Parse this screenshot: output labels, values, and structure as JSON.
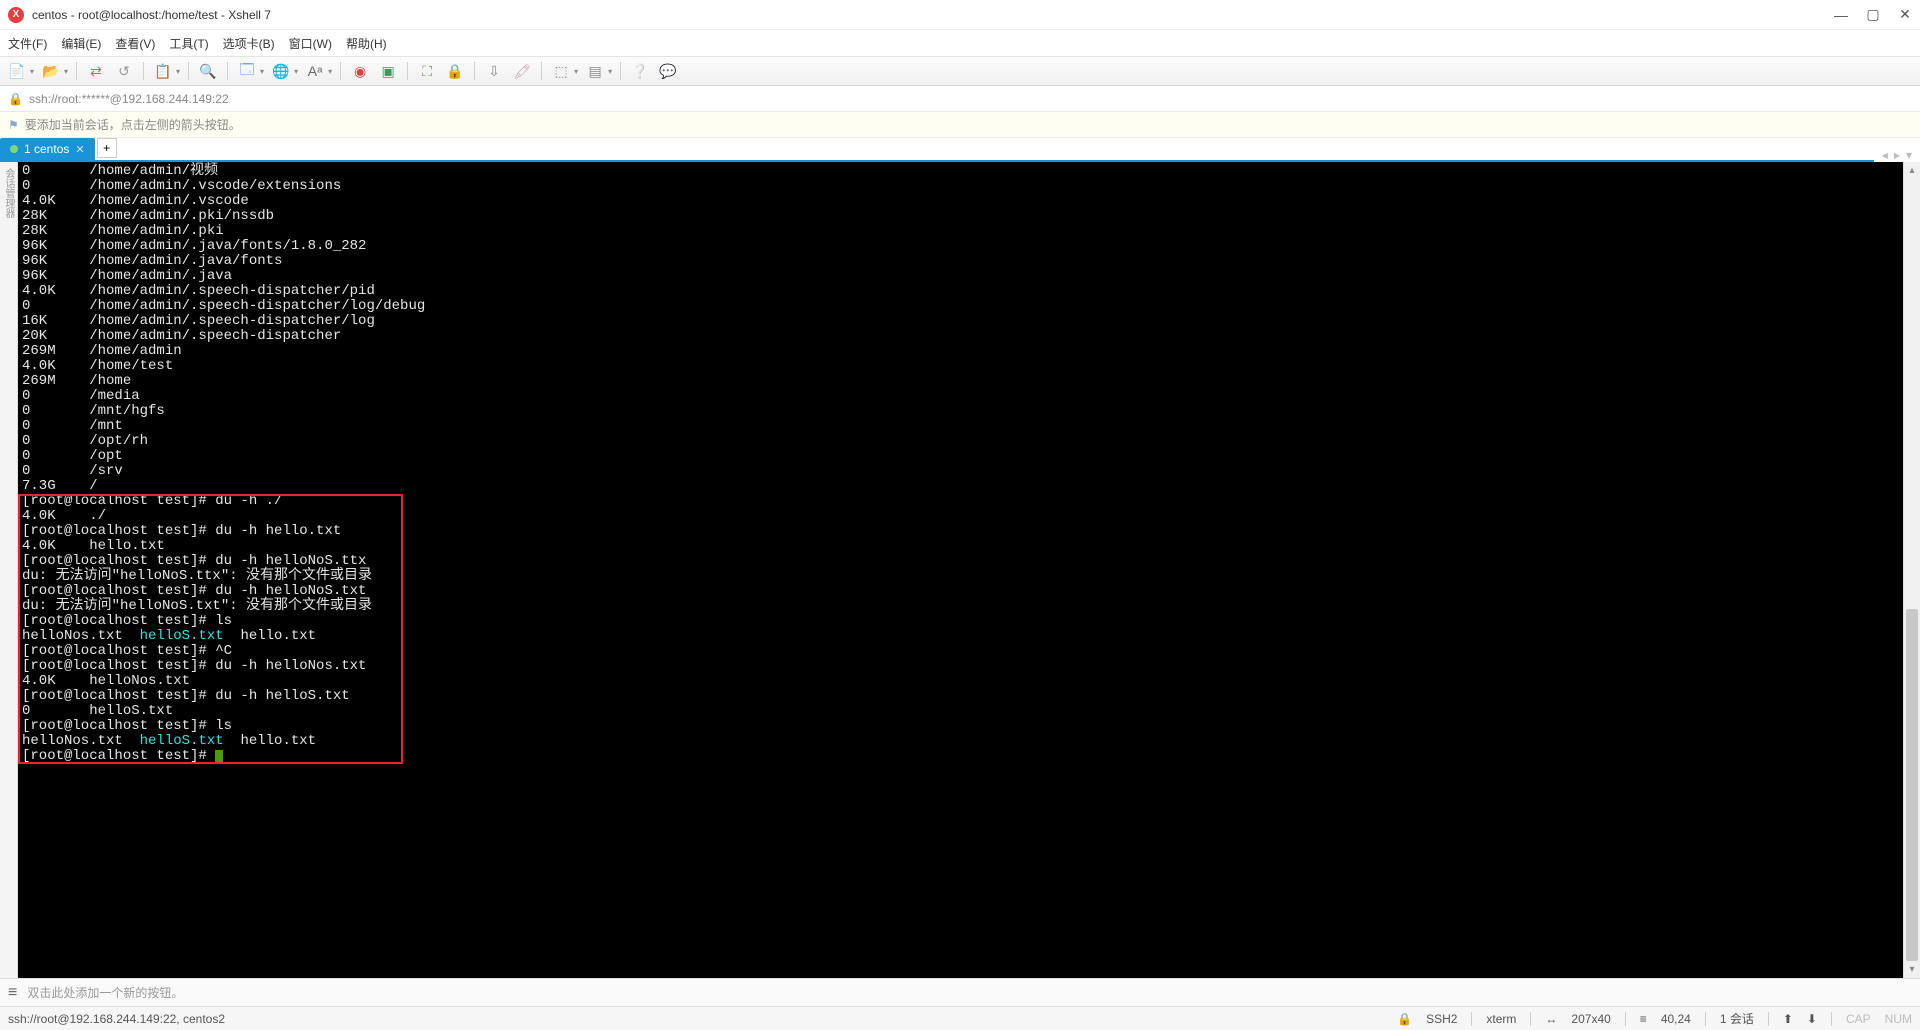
{
  "window": {
    "title": "centos - root@localhost:/home/test - Xshell 7",
    "app_icon_label": "X"
  },
  "menu": {
    "file": "文件(F)",
    "edit": "编辑(E)",
    "view": "查看(V)",
    "tools": "工具(T)",
    "tabs": "选项卡(B)",
    "window": "窗口(W)",
    "help": "帮助(H)"
  },
  "addressbar": {
    "text": "ssh://root:******@192.168.244.149:22"
  },
  "hintbar": {
    "text": "要添加当前会话，点击左侧的箭头按钮。"
  },
  "tab": {
    "label": "1 centos"
  },
  "terminal": {
    "du_lines": [
      {
        "size": "0",
        "path": "/home/admin/视频"
      },
      {
        "size": "0",
        "path": "/home/admin/.vscode/extensions"
      },
      {
        "size": "4.0K",
        "path": "/home/admin/.vscode"
      },
      {
        "size": "28K",
        "path": "/home/admin/.pki/nssdb"
      },
      {
        "size": "28K",
        "path": "/home/admin/.pki"
      },
      {
        "size": "96K",
        "path": "/home/admin/.java/fonts/1.8.0_282"
      },
      {
        "size": "96K",
        "path": "/home/admin/.java/fonts"
      },
      {
        "size": "96K",
        "path": "/home/admin/.java"
      },
      {
        "size": "4.0K",
        "path": "/home/admin/.speech-dispatcher/pid"
      },
      {
        "size": "0",
        "path": "/home/admin/.speech-dispatcher/log/debug"
      },
      {
        "size": "16K",
        "path": "/home/admin/.speech-dispatcher/log"
      },
      {
        "size": "20K",
        "path": "/home/admin/.speech-dispatcher"
      },
      {
        "size": "269M",
        "path": "/home/admin"
      },
      {
        "size": "4.0K",
        "path": "/home/test"
      },
      {
        "size": "269M",
        "path": "/home"
      },
      {
        "size": "0",
        "path": "/media"
      },
      {
        "size": "0",
        "path": "/mnt/hgfs"
      },
      {
        "size": "0",
        "path": "/mnt"
      },
      {
        "size": "0",
        "path": "/opt/rh"
      },
      {
        "size": "0",
        "path": "/opt"
      },
      {
        "size": "0",
        "path": "/srv"
      },
      {
        "size": "7.3G",
        "path": "/"
      }
    ],
    "prompt": "[root@localhost test]# ",
    "cmd_du_dot": "du -h ./",
    "out_du_dot": {
      "size": "4.0K",
      "path": "./"
    },
    "cmd_du_hello": "du -h hello.txt",
    "out_du_hello": {
      "size": "4.0K",
      "path": "hello.txt"
    },
    "cmd_du_ttx": "du -h helloNoS.ttx",
    "err_ttx": "du: 无法访问\"helloNoS.ttx\": 没有那个文件或目录",
    "cmd_du_nos_txt": "du -h helloNoS.txt",
    "err_nos_txt": "du: 无法访问\"helloNoS.txt\": 没有那个文件或目录",
    "cmd_ls1": "ls",
    "ls_file1": "helloNos.txt",
    "ls_file2": "helloS.txt",
    "ls_file3": "hello.txt",
    "cmd_ctrl_c": "^C",
    "cmd_du_nos": "du -h helloNos.txt",
    "out_du_nos": {
      "size": "4.0K",
      "path": "helloNos.txt"
    },
    "cmd_du_s": "du -h helloS.txt",
    "out_du_s": {
      "size": "0",
      "path": "helloS.txt"
    },
    "cmd_ls2": "ls"
  },
  "bottombar": {
    "hint": "双击此处添加一个新的按钮。"
  },
  "statusbar": {
    "left": "ssh://root@192.168.244.149:22, centos2",
    "ssh": "SSH2",
    "term": "xterm",
    "size": "207x40",
    "cursor": "40,24",
    "sessions": "1 会话",
    "cap": "CAP",
    "num": "NUM",
    "arrows": "↑",
    "size_icon": "�記"
  },
  "leftslab": {
    "label": "会话管理器"
  }
}
